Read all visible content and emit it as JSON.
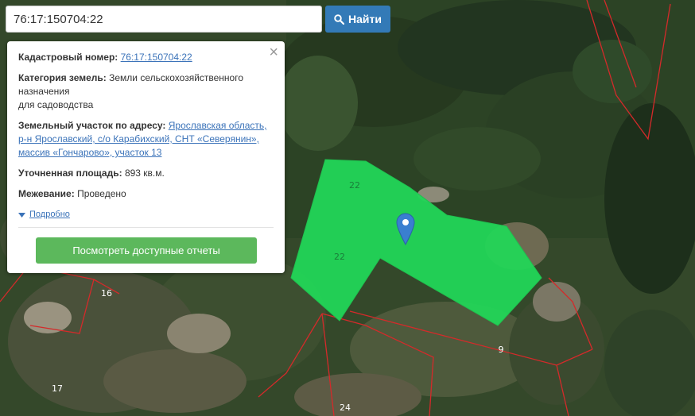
{
  "search": {
    "value": "76:17:150704:22",
    "button_label": "Найти",
    "button_icon": "search-icon"
  },
  "panel": {
    "cadastral_label": "Кадастровый номер:",
    "cadastral_value": "76:17:150704:22",
    "category_label": "Категория земель:",
    "category_line1": "Земли сельскохозяйственного",
    "category_line2": "назначения",
    "category_line3": "для садоводства",
    "address_label": "Земельный участок по адресу:",
    "address_line1": "Ярославская область,",
    "address_line2": "р-н Ярославский, с/о Карабихский, СНТ «Северянин»,",
    "address_line3": "массив «Гончарово», участок 13",
    "area_label": "Уточненная площадь:",
    "area_value": "893 кв.м.",
    "survey_label": "Межевание:",
    "survey_value": "Проведено",
    "details_label": "Подробно",
    "reports_button": "Посмотреть доступные отчеты",
    "close_icon": "close-icon"
  },
  "map": {
    "parcel_labels": [
      "22",
      "22",
      "16",
      "9",
      "17",
      "24"
    ],
    "marker_icon": "map-pin-icon",
    "colors": {
      "parcel_fill": "#22d657",
      "boundary": "#d42a2a",
      "marker": "#3a7fd0",
      "button_blue": "#337ab7",
      "button_green": "#5cb85c"
    }
  }
}
